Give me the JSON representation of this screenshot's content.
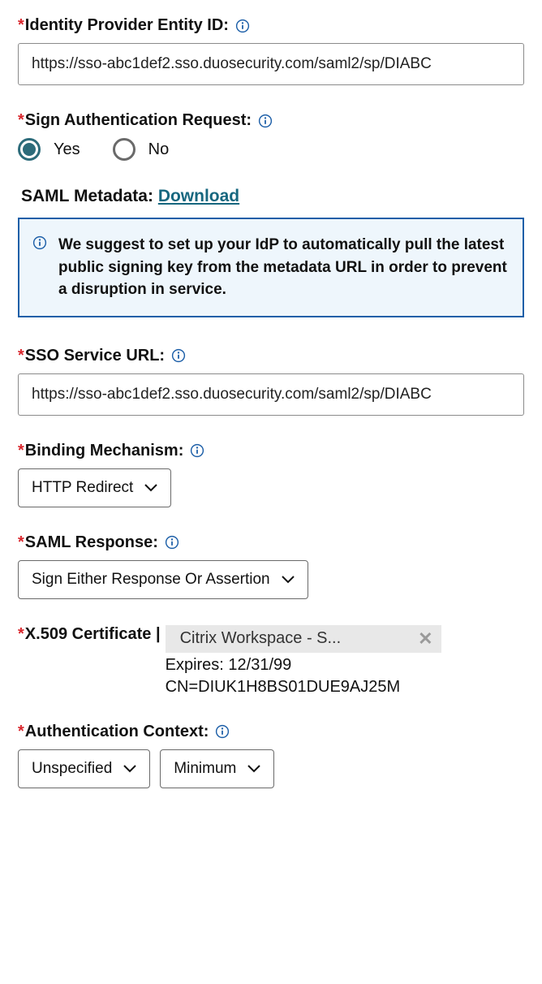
{
  "fields": {
    "entity_id": {
      "label": "Identity Provider Entity ID:",
      "value": "https://sso-abc1def2.sso.duosecurity.com/saml2/sp/DIABC"
    },
    "sign_auth": {
      "label": "Sign Authentication Request:",
      "option_yes": "Yes",
      "option_no": "No"
    },
    "metadata": {
      "label": "SAML Metadata:",
      "link_text": "Download"
    },
    "info_box": {
      "text": "We suggest to set up your IdP to automatically pull the latest public signing key from the metadata URL in order to prevent a disruption in service."
    },
    "sso_url": {
      "label": "SSO Service URL:",
      "value": "https://sso-abc1def2.sso.duosecurity.com/saml2/sp/DIABC"
    },
    "binding": {
      "label": "Binding Mechanism:",
      "value": "HTTP Redirect"
    },
    "saml_response": {
      "label": "SAML Response:",
      "value": "Sign Either Response Or Assertion"
    },
    "cert": {
      "label": "X.509 Certificate",
      "divider": "|",
      "chip": "Citrix Workspace - S...",
      "expires_label": "Expires:",
      "expires_value": "12/31/99",
      "cn": "CN=DIUK1H8BS01DUE9AJ25M"
    },
    "auth_context": {
      "label": "Authentication Context:",
      "value1": "Unspecified",
      "value2": "Minimum"
    }
  }
}
